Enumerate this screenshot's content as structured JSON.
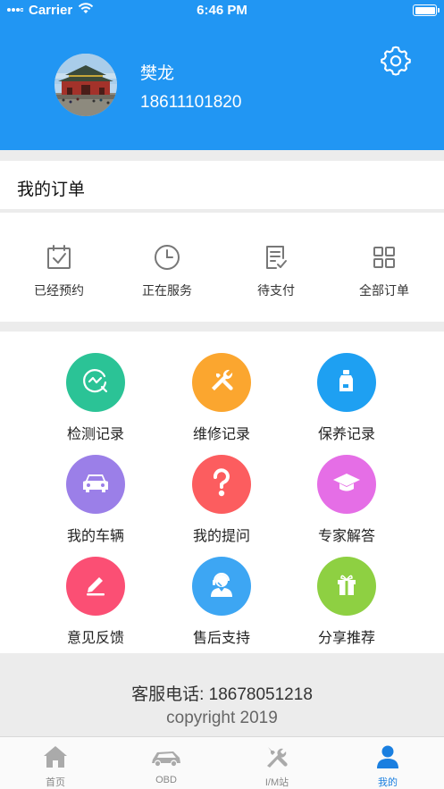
{
  "status_bar": {
    "carrier": "Carrier",
    "time": "6:46 PM"
  },
  "profile": {
    "name": "樊龙",
    "phone": "18611101820"
  },
  "orders": {
    "title": "我的订单",
    "items": [
      {
        "label": "已经预约",
        "icon": "calendar-check-icon"
      },
      {
        "label": "正在服务",
        "icon": "clock-icon"
      },
      {
        "label": "待支付",
        "icon": "document-check-icon"
      },
      {
        "label": "全部订单",
        "icon": "grid-icon"
      }
    ]
  },
  "services": [
    {
      "label": "检测记录",
      "icon": "inspection-icon",
      "color": "#2bc396"
    },
    {
      "label": "维修记录",
      "icon": "repair-tools-icon",
      "color": "#fba62f"
    },
    {
      "label": "保养记录",
      "icon": "oil-bottle-icon",
      "color": "#1ea0f2"
    },
    {
      "label": "我的车辆",
      "icon": "car-icon",
      "color": "#9b7fe8"
    },
    {
      "label": "我的提问",
      "icon": "question-icon",
      "color": "#fc5d5f"
    },
    {
      "label": "专家解答",
      "icon": "graduation-cap-icon",
      "color": "#e56ee6"
    },
    {
      "label": "意见反馈",
      "icon": "pencil-icon",
      "color": "#fb4f74"
    },
    {
      "label": "售后支持",
      "icon": "support-agent-icon",
      "color": "#3da6f3"
    },
    {
      "label": "分享推荐",
      "icon": "gift-icon",
      "color": "#8ed042"
    }
  ],
  "footer": {
    "phone": "客服电话: 18678051218",
    "copyright": "copyright 2019"
  },
  "tabs": [
    {
      "label": "首页",
      "icon": "home-icon"
    },
    {
      "label": "OBD",
      "icon": "car-obd-icon"
    },
    {
      "label": "I/M站",
      "icon": "tools-icon"
    },
    {
      "label": "我的",
      "icon": "user-icon"
    }
  ],
  "colors": {
    "primary": "#2196f3",
    "active_tab": "#1a7fe0"
  }
}
